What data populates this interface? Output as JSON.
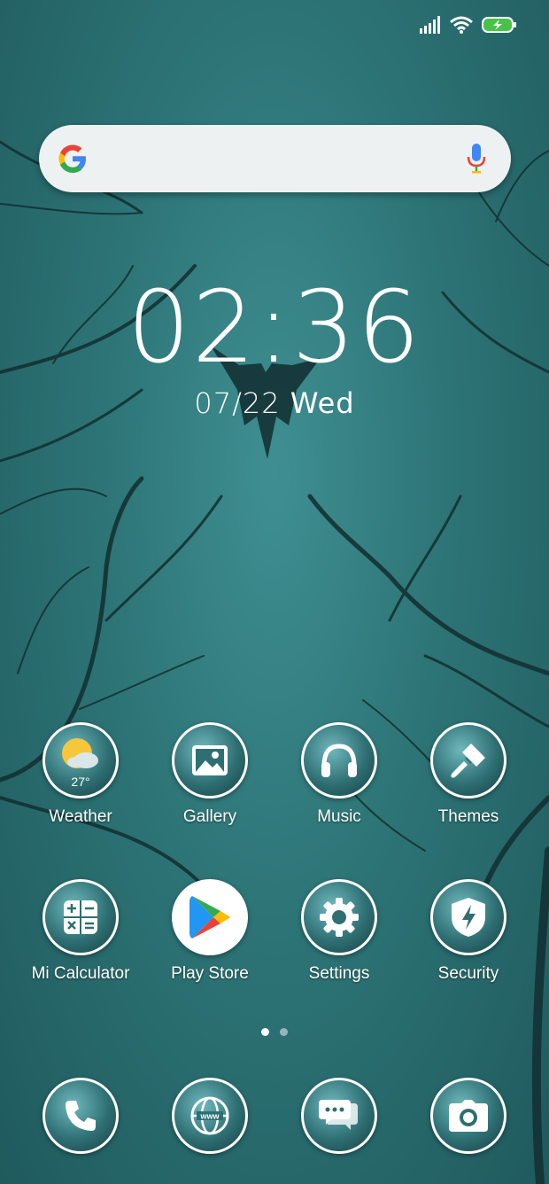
{
  "status_bar": {
    "signal": "signal-icon",
    "wifi": "wifi-icon",
    "battery": "battery-charging-icon"
  },
  "search": {
    "logo": "google-g-icon",
    "mic": "mic-icon"
  },
  "clock": {
    "time": "02:36",
    "date": "07/22",
    "weekday": "Wed"
  },
  "apps": [
    {
      "label": "Weather",
      "icon": "weather-icon",
      "temp": "27°"
    },
    {
      "label": "Gallery",
      "icon": "gallery-icon"
    },
    {
      "label": "Music",
      "icon": "headphones-icon"
    },
    {
      "label": "Themes",
      "icon": "brush-icon"
    },
    {
      "label": "Mi Calculator",
      "icon": "calculator-icon"
    },
    {
      "label": "Play Store",
      "icon": "play-store-icon"
    },
    {
      "label": "Settings",
      "icon": "gear-icon"
    },
    {
      "label": "Security",
      "icon": "shield-icon"
    }
  ],
  "pager": {
    "pages": 2,
    "active": 1
  },
  "dock": [
    {
      "icon": "phone-icon"
    },
    {
      "icon": "browser-icon",
      "text": "www"
    },
    {
      "icon": "messages-icon"
    },
    {
      "icon": "camera-icon"
    }
  ]
}
